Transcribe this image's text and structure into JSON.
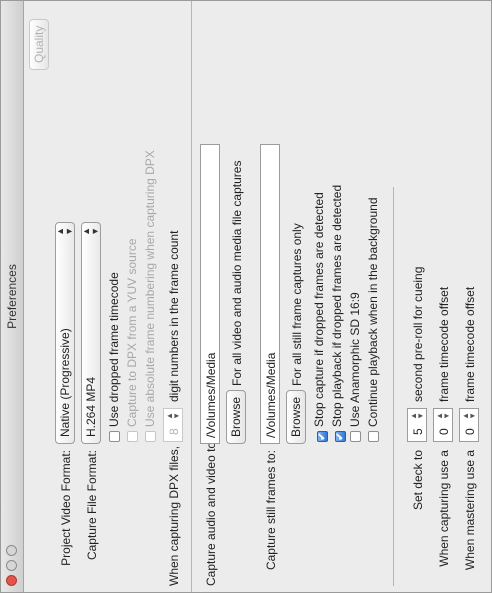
{
  "window": {
    "title": "Preferences"
  },
  "quality_button": "Quality",
  "project_video_format": {
    "label": "Project Video Format:",
    "value": "Native (Progressive)"
  },
  "capture_file_format": {
    "label": "Capture File Format:",
    "value": "H.264 MP4"
  },
  "checkboxes_format": [
    {
      "label": "Use dropped frame timecode",
      "checked": false,
      "enabled": true
    },
    {
      "label": "Capture to DPX from a YUV source",
      "checked": false,
      "enabled": false
    },
    {
      "label": "Use absolute frame numbering when capturing DPX",
      "checked": false,
      "enabled": false
    }
  ],
  "dpx": {
    "label": "When capturing DPX files, use",
    "value": "8",
    "suffix": "digit numbers in the frame count"
  },
  "capture_audio_video": {
    "label": "Capture audio and video to:",
    "path": "/Volumes/Media",
    "browse": "Browse",
    "note": "For all video and audio media file captures"
  },
  "capture_still": {
    "label": "Capture still frames to:",
    "path": "/Volumes/Media",
    "browse": "Browse",
    "note": "For all still frame captures only"
  },
  "checkboxes_capture": [
    {
      "label": "Stop capture if dropped frames are detected",
      "checked": true,
      "enabled": true
    },
    {
      "label": "Stop playback if dropped frames are detected",
      "checked": true,
      "enabled": true
    },
    {
      "label": "Use Anamorphic SD 16:9",
      "checked": false,
      "enabled": true
    },
    {
      "label": "Continue playback when in the background",
      "checked": false,
      "enabled": true
    }
  ],
  "deck": {
    "label": "Set deck to",
    "value": "5",
    "suffix": "second pre-roll for cueing"
  },
  "capturing_offset": {
    "label": "When capturing use a",
    "value": "0",
    "suffix": "frame timecode offset"
  },
  "mastering_offset": {
    "label": "When mastering use a",
    "value": "0",
    "suffix": "frame timecode offset"
  },
  "icons": {
    "checkmark": "✔",
    "stepper": "▲▼",
    "popup_arrows": "▲▼"
  }
}
